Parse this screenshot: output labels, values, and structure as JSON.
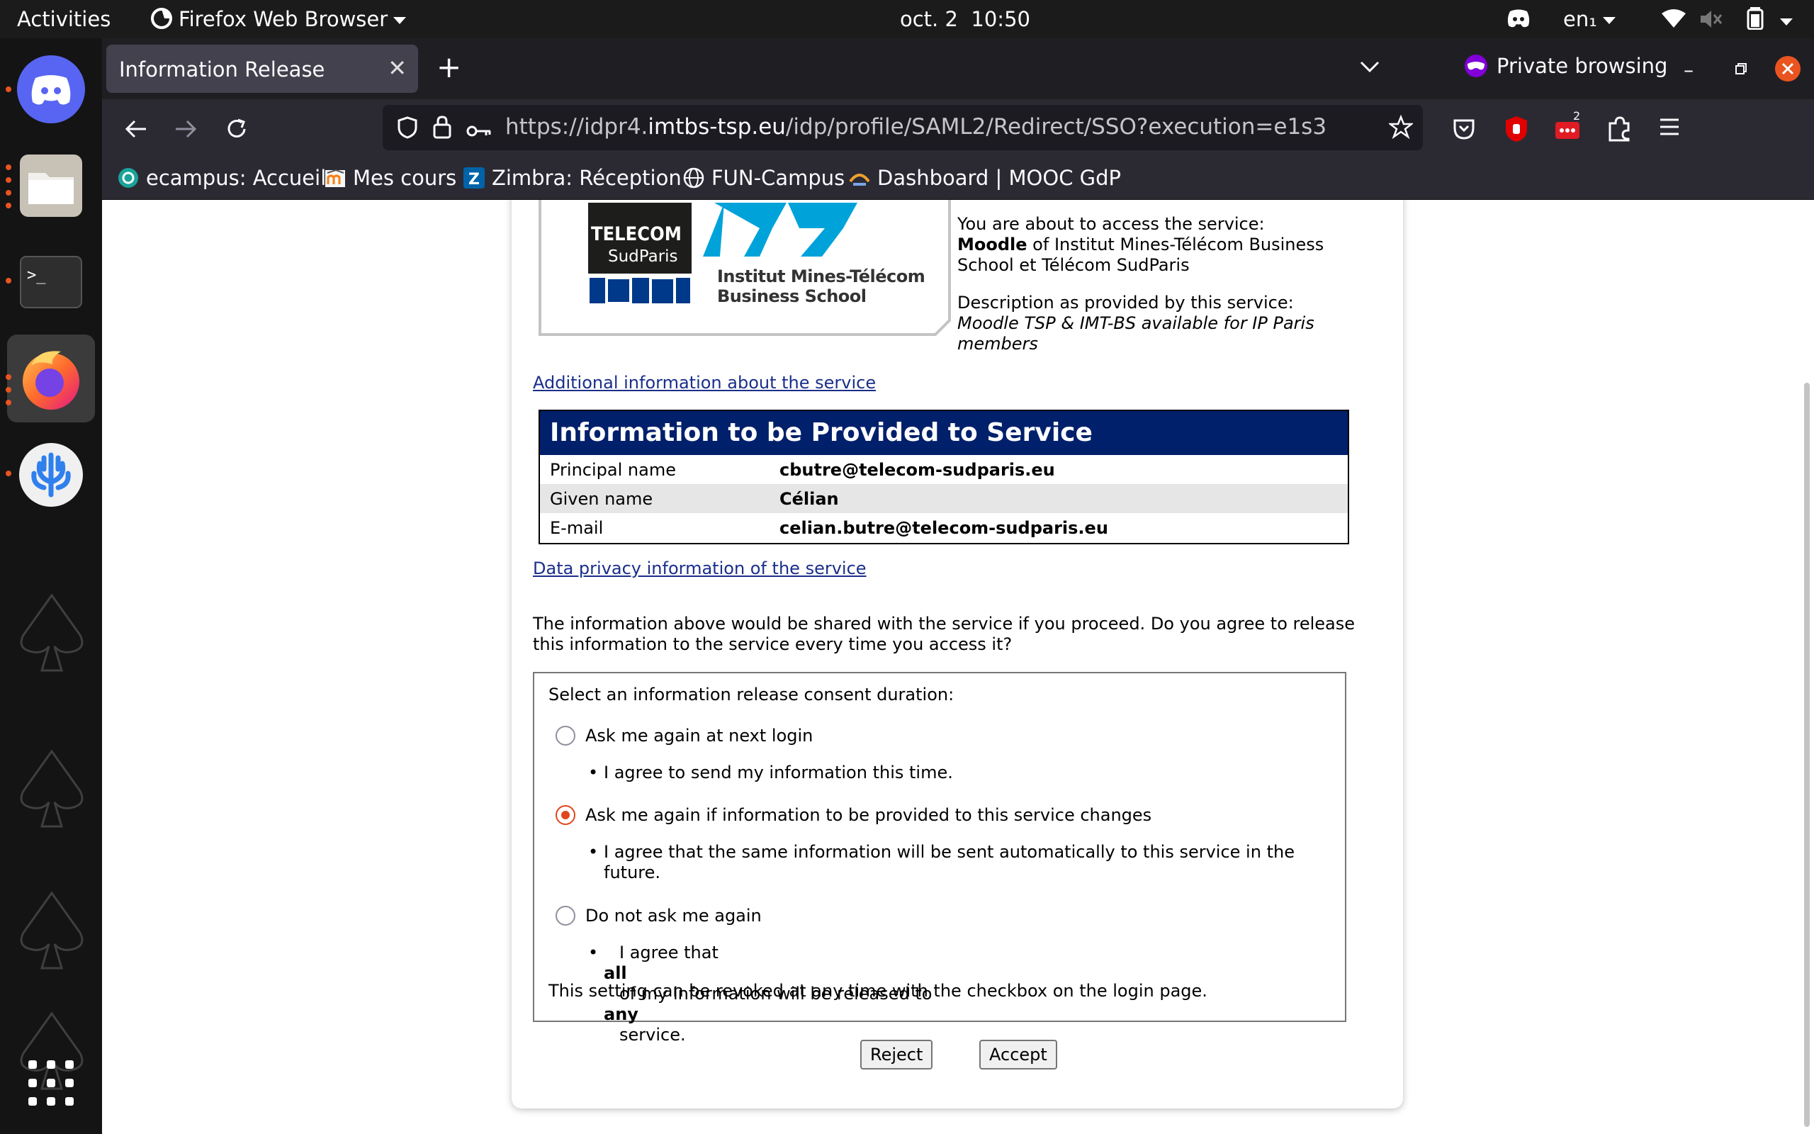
{
  "system": {
    "activities": "Activities",
    "app_name": "Firefox Web Browser",
    "date": "oct. 2",
    "time": "10:50",
    "keyboard_layout": "en₁"
  },
  "browser": {
    "tab_title": "Information Release",
    "private_label": "Private browsing",
    "url_prefix": "https://idpr4.",
    "url_domain": "imtbs-tsp.eu",
    "url_path": "/idp/profile/SAML2/Redirect/SSO?execution=e1s3",
    "extension_badge": "2",
    "bookmarks": [
      "ecampus: Accueil",
      "Mes cours",
      "Zimbra: Réception",
      "FUN-Campus",
      "Dashboard | MOOC GdP"
    ]
  },
  "logos": {
    "telecom": "TELECOM",
    "sudparis": "SudParis",
    "imt_line1": "Institut Mines-Télécom",
    "imt_line2": "Business School"
  },
  "service": {
    "access_intro": "You are about to access the service:",
    "service_name": "Moodle",
    "service_of": " of Institut Mines-Télécom Business School et Télécom SudParis",
    "desc_intro": "Description as provided by this service:",
    "description": "Moodle TSP & IMT-BS available for IP Paris members",
    "additional_link": "Additional information about the service",
    "privacy_link": "Data privacy information of the service"
  },
  "info_table": {
    "heading": "Information to be Provided to Service",
    "rows": [
      {
        "label": "Principal name",
        "value": "cbutre@telecom-sudparis.eu"
      },
      {
        "label": "Given name",
        "value": "Célian"
      },
      {
        "label": "E-mail",
        "value": "celian.butre@telecom-sudparis.eu"
      }
    ]
  },
  "consent": {
    "intro": "The information above would be shared with the service if you proceed. Do you agree to release this information to the service every time you access it?",
    "legend": "Select an information release consent duration:",
    "options": [
      {
        "label": "Ask me again at next login",
        "detail": "I agree to send my information this time.",
        "selected": false
      },
      {
        "label": "Ask me again if information to be provided to this service changes",
        "detail": "I agree that the same information will be sent automatically to this service in the future.",
        "selected": true
      },
      {
        "label": "Do not ask me again",
        "detail_a": "I agree that ",
        "detail_b": "all",
        "detail_c": " of my information will be released to ",
        "detail_d": "any",
        "detail_e": " service.",
        "selected": false
      }
    ],
    "revoke_note": "This setting can be revoked at any time with the checkbox on the login page.",
    "reject_label": "Reject",
    "accept_label": "Accept"
  }
}
